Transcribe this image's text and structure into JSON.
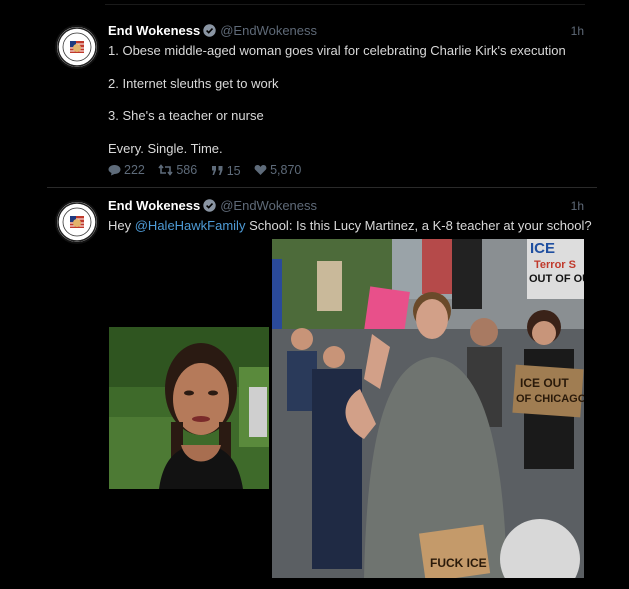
{
  "tweets": [
    {
      "author_name": "End Wokeness",
      "handle": "@EndWokeness",
      "time": "1h",
      "lines": [
        "1. Obese middle-aged woman goes viral for celebrating Charlie Kirk's execution",
        "2. Internet sleuths get to work",
        "3. She's a teacher or nurse",
        "Every. Single. Time."
      ],
      "stats": {
        "replies": "222",
        "retweets": "586",
        "quotes": "15",
        "likes": "5,870"
      }
    },
    {
      "author_name": "End Wokeness",
      "handle": "@EndWokeness",
      "time": "1h",
      "text_prefix": "Hey ",
      "mention": "@HaleHawkFamily",
      "text_suffix": " School: Is this Lucy Martinez, a K-8 teacher at your school?"
    }
  ],
  "photo2_signs": {
    "ice_top": "ICE",
    "terror_s": "Terror S",
    "out_of_ou": "OUT OF OU",
    "ice_out_line1": "ICE OUT",
    "ice_out_line2": "OF CHICAGO",
    "fuck_ice": "FUCK ICE"
  },
  "colors": {
    "background": "#000000",
    "name": "#ffffff",
    "handle": "#5f6a78",
    "mention": "#4e9bd6",
    "verified": "#8a95a3"
  },
  "icons": [
    "verified-badge-icon",
    "reply-icon",
    "retweet-icon",
    "quote-icon",
    "like-icon"
  ]
}
